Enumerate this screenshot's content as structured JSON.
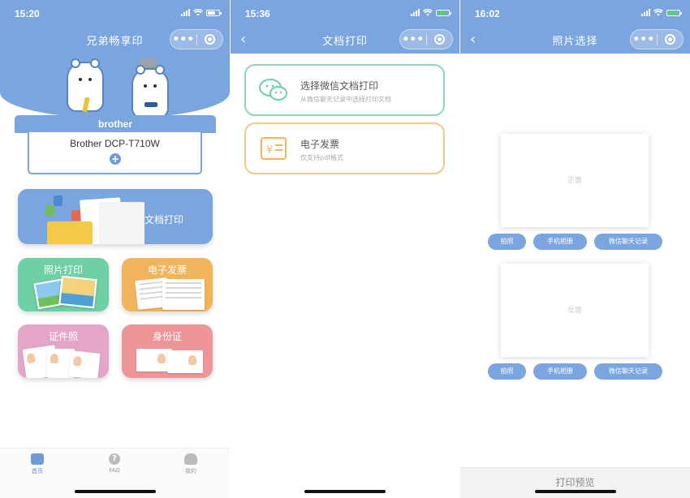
{
  "screens": {
    "home": {
      "time": "15:20",
      "title": "兄弟畅享印",
      "brand": "brother",
      "printer_name": "Brother DCP-T710W",
      "add_symbol": "+",
      "cards": {
        "doc_print": "文档打印",
        "photo_print": "照片打印",
        "invoice": "电子发票",
        "id_photo": "证件照",
        "id_card": "身份证"
      },
      "tabs": {
        "home": "首页",
        "faq": "FAQ",
        "mine": "我的"
      }
    },
    "doc": {
      "time": "15:36",
      "title": "文档打印",
      "wechat_title": "选择微信文档打印",
      "wechat_sub": "从微信聊天记录中选择打印文档",
      "invoice_title": "电子发票",
      "invoice_sub": "仅支持pdf格式"
    },
    "photo": {
      "time": "16:02",
      "title": "照片选择",
      "front_label": "正面",
      "back_label": "反面",
      "buttons": {
        "camera": "拍照",
        "album": "手机相册",
        "wechat": "微信聊天记录"
      },
      "preview": "打印预览"
    }
  },
  "capsule": {
    "more": "•••"
  },
  "colors": {
    "primary": "#7aa5de",
    "photo_card": "#6fd0a6",
    "invoice_card": "#f0b55c",
    "id_photo_card": "#e4a6c8",
    "id_card_card": "#ee9697",
    "wechat_border": "#8cd8b8",
    "invoice_border": "#f3c98a"
  },
  "icons": [
    "wifi-icon",
    "signal-icon",
    "battery-icon",
    "back-icon",
    "more-icon",
    "close-target-icon",
    "plus-icon",
    "wechat-icon",
    "invoice-icon",
    "print-tab-icon",
    "faq-tab-icon",
    "profile-tab-icon"
  ]
}
